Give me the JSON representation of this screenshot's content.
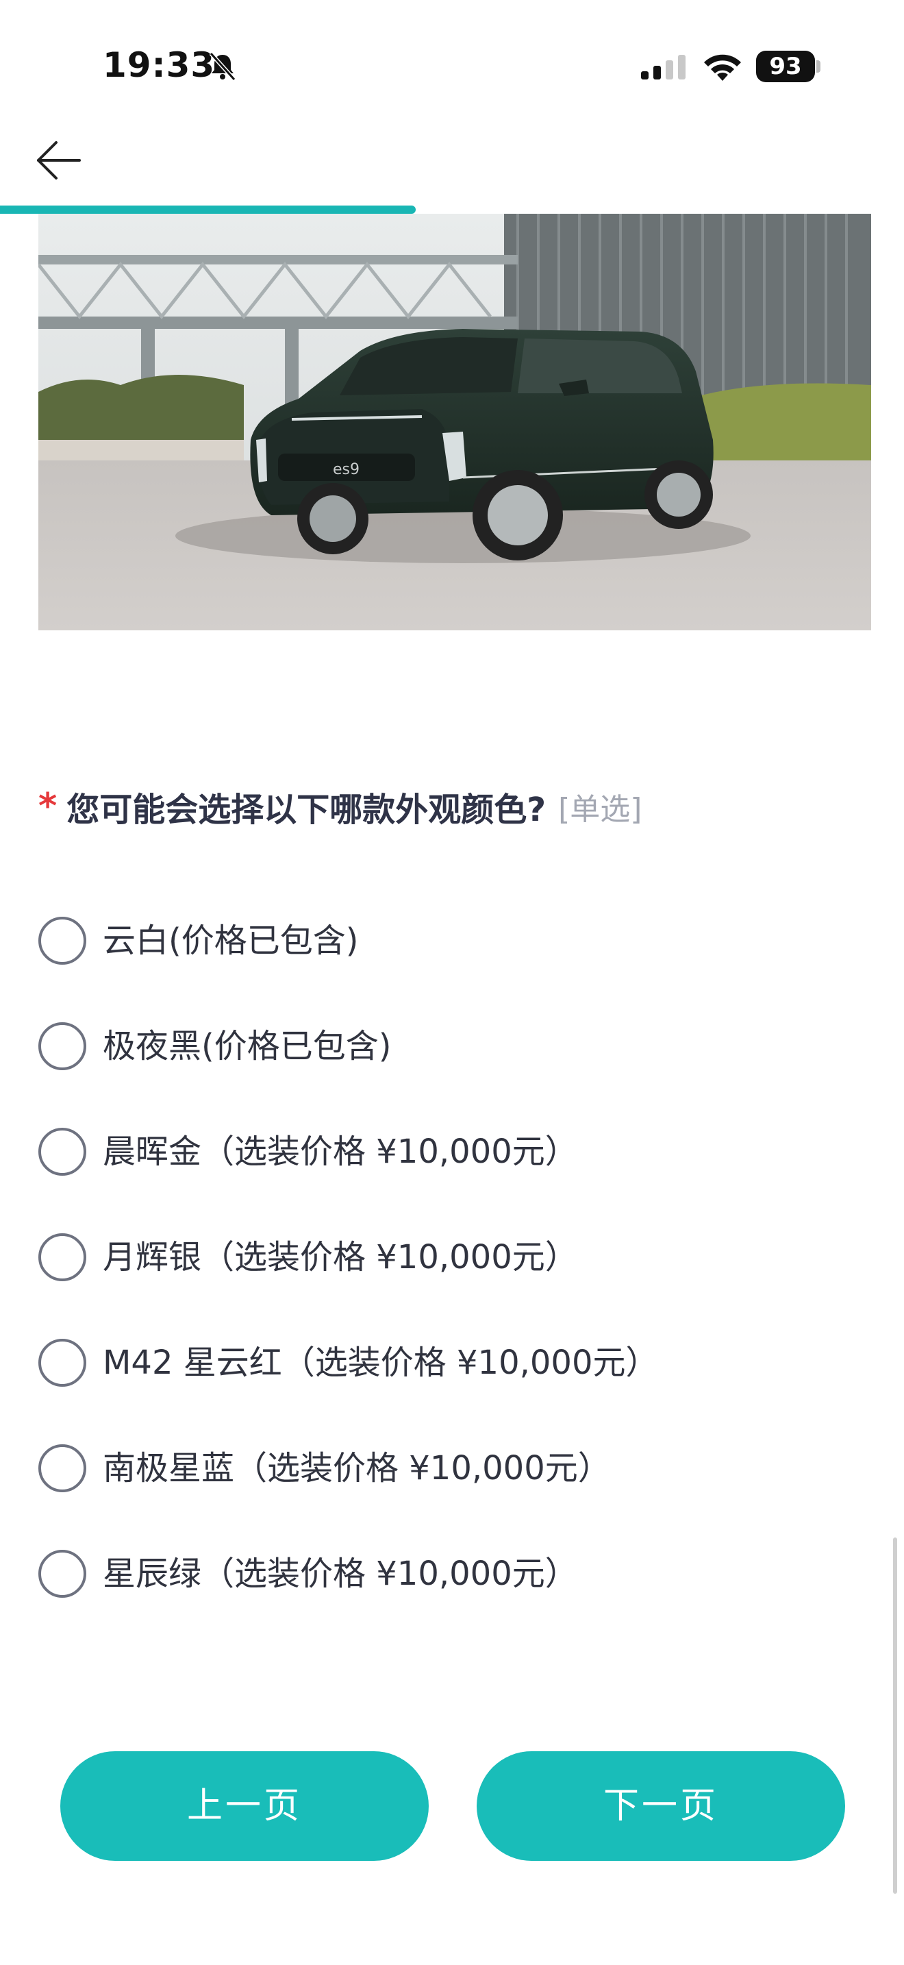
{
  "status_bar": {
    "time": "19:33",
    "battery": "93",
    "icons": [
      "mute-icon",
      "signal-icon",
      "wifi-icon",
      "battery-icon"
    ]
  },
  "nav": {
    "back_icon": "arrow-left-icon",
    "progress": 0.46,
    "accent_color": "#19b6b4"
  },
  "question": {
    "required_mark": "*",
    "text": "您可能会选择以下哪款外观颜色?",
    "type_tag": "[单选]"
  },
  "options": [
    {
      "label": "云白(价格已包含)",
      "selected": false
    },
    {
      "label": "极夜黑(价格已包含)",
      "selected": false
    },
    {
      "label": "晨晖金（选装价格 ¥10,000元）",
      "selected": false
    },
    {
      "label": "月辉银（选装价格 ¥10,000元）",
      "selected": false
    },
    {
      "label": "M42 星云红（选装价格 ¥10,000元）",
      "selected": false
    },
    {
      "label": "南极星蓝（选装价格 ¥10,000元）",
      "selected": false
    },
    {
      "label": "星辰绿（选装价格 ¥10,000元）",
      "selected": false
    }
  ],
  "buttons": {
    "prev": "上一页",
    "next": "下一页",
    "color": "#19bdb9"
  }
}
